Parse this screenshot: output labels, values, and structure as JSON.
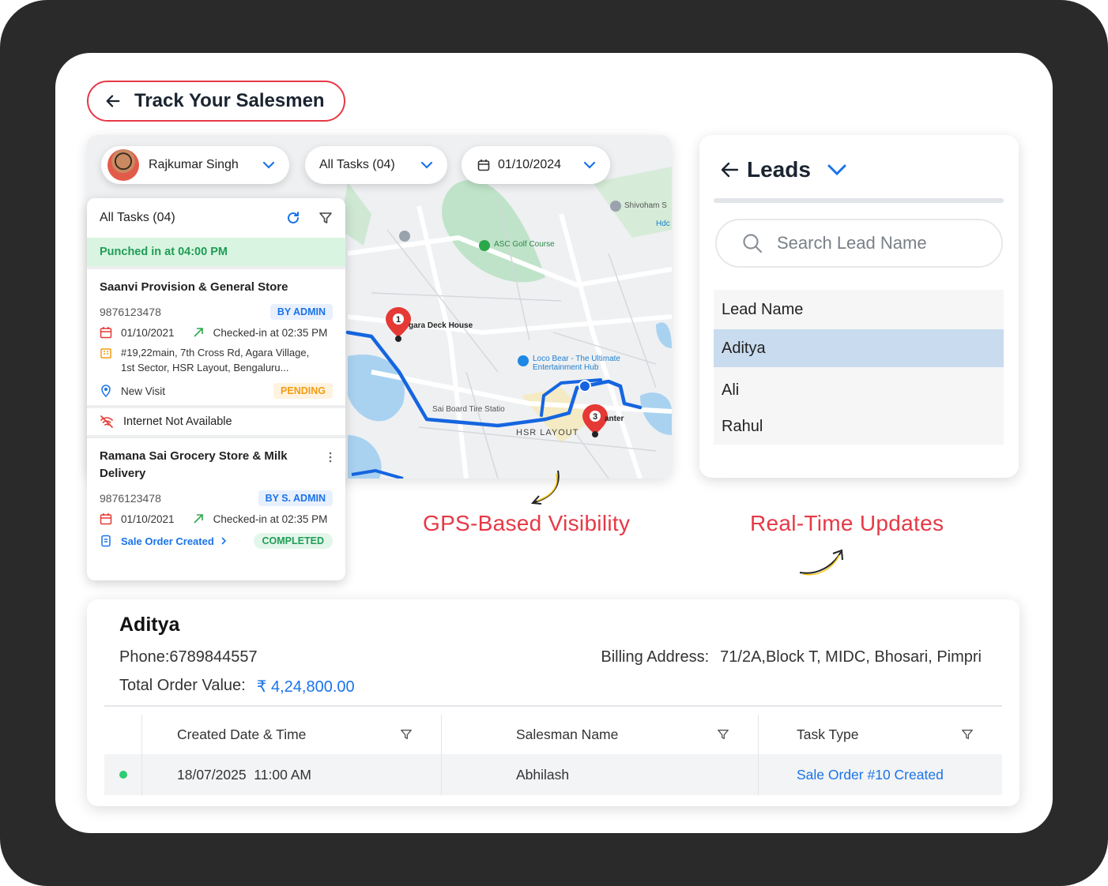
{
  "header": {
    "title": "Track Your Salesmen"
  },
  "filters": {
    "salesman": "Rajkumar Singh",
    "tasks": "All Tasks (04)",
    "date": "01/10/2024"
  },
  "map": {
    "labels": [
      "Shivoham S",
      "ASC Golf Course",
      "gara Deck House",
      "Loco Bear - The Ultimate",
      "Entertainment Hub",
      "HSR LAYOUT",
      "Sai Board Tire Statio",
      "anter",
      "Hdc"
    ],
    "pins": [
      "1",
      "3"
    ]
  },
  "tasks_panel": {
    "title": "All Tasks (04)",
    "punched": "Punched in at 04:00 PM",
    "task1": {
      "name": "Saanvi Provision & General Store",
      "phone": "9876123478",
      "badge": "BY ADMIN",
      "date": "01/10/2021",
      "checkin": "Checked-in at 02:35 PM",
      "address_line1": "#19,22main, 7th Cross Rd, Agara Village,",
      "address_line2": "1st Sector, HSR Layout, Bengaluru...",
      "visit": "New Visit",
      "status": "PENDING"
    },
    "internet": "Internet Not Available",
    "task2": {
      "name_line1": "Ramana Sai Grocery Store & Milk",
      "name_line2": "Delivery",
      "phone": "9876123478",
      "badge": "BY S. ADMIN",
      "date": "01/10/2021",
      "checkin": "Checked-in at 02:35 PM",
      "order": "Sale Order Created",
      "status": "COMPLETED"
    }
  },
  "callouts": {
    "gps": "GPS-Based Visibility",
    "realtime": "Real-Time Updates"
  },
  "leads": {
    "title": "Leads",
    "search_placeholder": "Search Lead Name",
    "header": "Lead Name",
    "items": [
      "Aditya",
      "Ali",
      "Rahul"
    ]
  },
  "detail": {
    "name": "Aditya",
    "phone": "Phone:6789844557",
    "total_label": "Total Order Value:",
    "total_value": "₹ 4,24,800.00",
    "billing_label": "Billing Address:",
    "billing_value": "71/2A,Block T, MIDC, Bhosari, Pimpri",
    "columns": [
      "Created Date & Time",
      "Salesman Name",
      "Task Type"
    ],
    "row": {
      "datetime": "18/07/2025  11:00 AM",
      "salesman": "Abhilash",
      "task": "Sale Order #10 Created"
    }
  },
  "colors": {
    "accent": "#e63946",
    "link": "#1a73e8",
    "success": "#1f9d55",
    "route": "#1565e0"
  }
}
